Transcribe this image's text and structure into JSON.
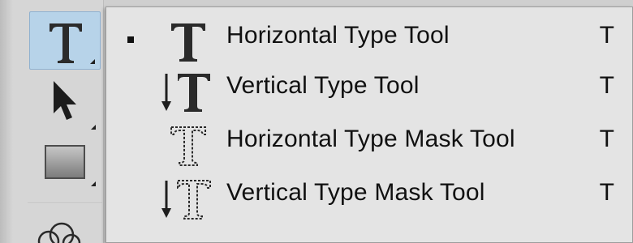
{
  "toolbar": {
    "tools": [
      {
        "name": "type-tool",
        "icon": "type-T-icon",
        "active": true
      },
      {
        "name": "move-tool",
        "icon": "arrow-cursor-icon",
        "active": false
      },
      {
        "name": "rectangle-tool",
        "icon": "rectangle-icon",
        "active": false
      },
      {
        "name": "clone-tool",
        "icon": "clone-shapes-icon",
        "active": false
      }
    ]
  },
  "flyout": {
    "items": [
      {
        "label": "Horizontal Type Tool",
        "shortcut": "T",
        "icon": "horizontal-type-icon",
        "selected": true
      },
      {
        "label": "Vertical Type Tool",
        "shortcut": "T",
        "icon": "vertical-type-icon",
        "selected": false
      },
      {
        "label": "Horizontal Type Mask Tool",
        "shortcut": "T",
        "icon": "horizontal-type-mask-icon",
        "selected": false
      },
      {
        "label": "Vertical Type Mask Tool",
        "shortcut": "T",
        "icon": "vertical-type-mask-icon",
        "selected": false
      }
    ]
  },
  "colors": {
    "toolbar_bg": "#d6d6d6",
    "flyout_bg": "#e4e4e4",
    "active_bg": "#b7d3e9",
    "text": "#111111"
  }
}
